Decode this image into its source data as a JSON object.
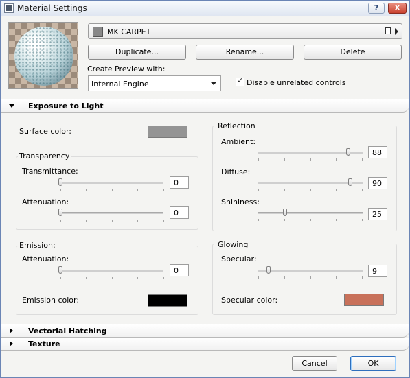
{
  "window": {
    "title": "Material Settings",
    "help_label": "?",
    "close_label": "X"
  },
  "material": {
    "name": "MK CARPET",
    "swatch_color": "#888888"
  },
  "buttons": {
    "duplicate": "Duplicate...",
    "rename": "Rename...",
    "delete": "Delete",
    "cancel": "Cancel",
    "ok": "OK"
  },
  "preview": {
    "label": "Create Preview with:",
    "engine": "Internal Engine"
  },
  "disable_controls": {
    "label": "Disable unrelated controls",
    "checked": true
  },
  "sections": {
    "exposure": "Exposure to Light",
    "hatching": "Vectorial Hatching",
    "texture": "Texture"
  },
  "exposure": {
    "surface_color": {
      "label": "Surface color:",
      "color": "#949494"
    },
    "transparency": {
      "title": "Transparency",
      "transmittance": {
        "label": "Transmittance:",
        "value": "0"
      },
      "attenuation": {
        "label": "Attenuation:",
        "value": "0"
      }
    },
    "emission": {
      "title": "Emission:",
      "attenuation": {
        "label": "Attenuation:",
        "value": "0"
      },
      "color": {
        "label": "Emission color:",
        "color": "#000000"
      }
    },
    "reflection": {
      "title": "Reflection",
      "ambient": {
        "label": "Ambient:",
        "value": "88"
      },
      "diffuse": {
        "label": "Diffuse:",
        "value": "90"
      },
      "shininess": {
        "label": "Shininess:",
        "value": "25"
      }
    },
    "glowing": {
      "title": "Glowing",
      "specular": {
        "label": "Specular:",
        "value": "9"
      },
      "specular_color": {
        "label": "Specular color:",
        "color": "#c8715a"
      }
    }
  }
}
